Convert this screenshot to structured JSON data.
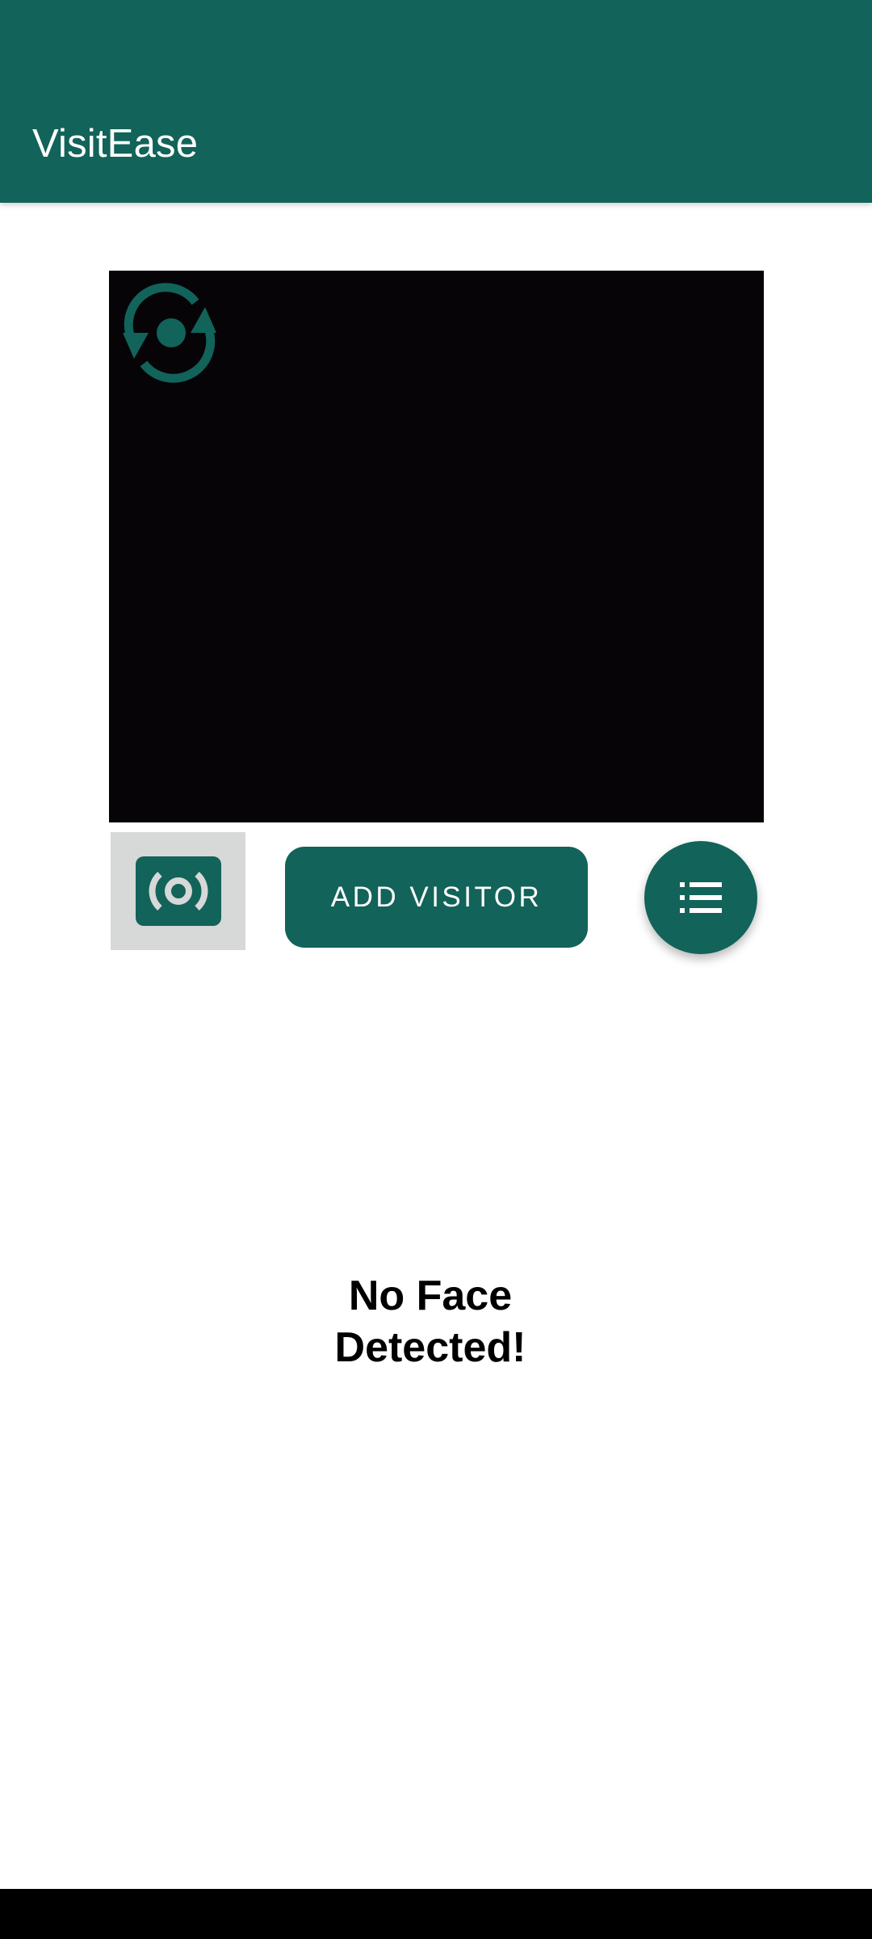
{
  "app_bar": {
    "title": "VisitEase",
    "color": "#126359"
  },
  "camera": {
    "preview_color": "#060407",
    "switch_icon": "switch-camera-icon",
    "capture_icon": "camera-capture-icon"
  },
  "actions": {
    "add_visitor_label": "ADD VISITOR",
    "list_icon": "list-icon"
  },
  "status": {
    "line1": "No Face",
    "line2": "Detected!"
  },
  "colors": {
    "accent": "#126359",
    "capture_bg": "#d7d8d8"
  }
}
